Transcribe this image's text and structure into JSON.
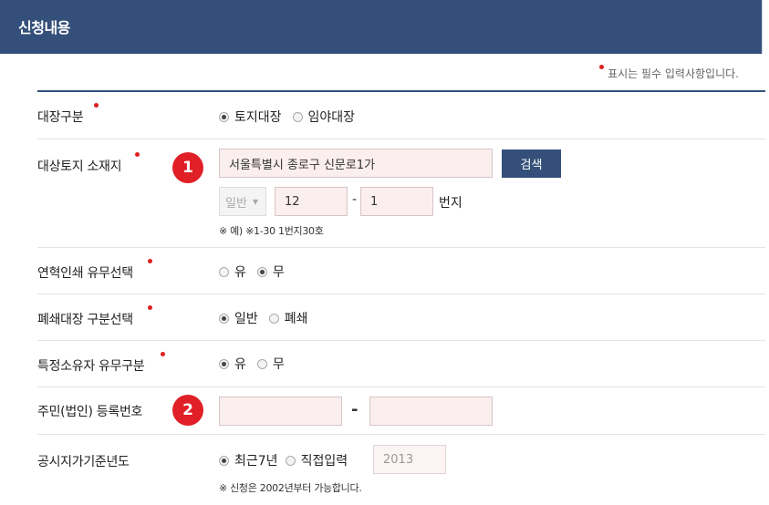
{
  "header": {
    "title": "신청내용"
  },
  "required_note": "표시는 필수 입력사항입니다.",
  "rows": {
    "ledger_type": {
      "label": "대장구분",
      "options": [
        "토지대장",
        "임야대장"
      ],
      "selected": "토지대장"
    },
    "land_location": {
      "label": "대상토지 소재지",
      "badge": "1",
      "address_value": "서울특별시 종로구 신문로1가",
      "search_label": "검색",
      "lot_type": "일반",
      "main_number": "12",
      "dash": "-",
      "sub_number": "1",
      "unit_label": "번지",
      "example_note": "※ 예) ※1-30 1번지30호"
    },
    "history_print": {
      "label": "연혁인쇄 유무선택",
      "options": [
        "유",
        "무"
      ],
      "selected": "무"
    },
    "closed_ledger": {
      "label": "폐쇄대장 구분선택",
      "options": [
        "일반",
        "폐쇄"
      ],
      "selected": "일반"
    },
    "specific_owner": {
      "label": "특정소유자 유무구분",
      "options": [
        "유",
        "무"
      ],
      "selected": "유"
    },
    "resident_number": {
      "label": "주민(법인) 등록번호",
      "badge": "2",
      "part1": "",
      "dash": "-",
      "part2": ""
    },
    "price_year": {
      "label": "공시지가기준년도",
      "options": [
        "최근7년",
        "직접입력"
      ],
      "selected": "최근7년",
      "year_placeholder": "2013",
      "note": "※ 신청은 2002년부터 가능합니다."
    }
  },
  "colors": {
    "header_bg": "#34507a",
    "required_dot": "#e02020",
    "badge": "#e01f26",
    "input_bg": "#fbeeee"
  }
}
